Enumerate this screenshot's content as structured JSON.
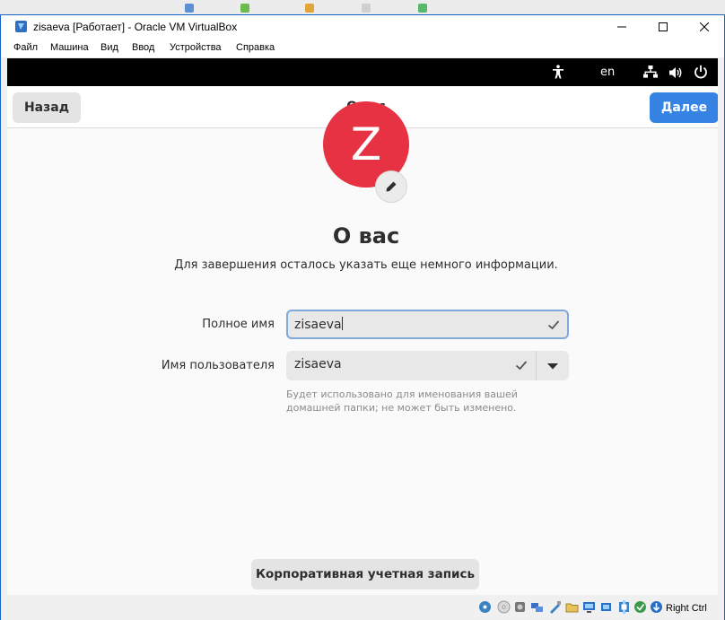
{
  "window": {
    "title": "zisaeva [Работает] - Oracle VM VirtualBox",
    "controls": [
      "minimize-icon",
      "maximize-icon",
      "close-icon"
    ]
  },
  "menubar": {
    "items": [
      "Файл",
      "Машина",
      "Вид",
      "Ввод",
      "Устройства",
      "Справка"
    ]
  },
  "topbar": {
    "accessibility_icon": "accessibility-icon",
    "language": "en",
    "status_icons": [
      "network-icon",
      "volume-icon",
      "power-icon"
    ]
  },
  "header": {
    "back_label": "Назад",
    "title": "О вас",
    "next_label": "Далее"
  },
  "avatar": {
    "initial": "Z",
    "color": "#e63242",
    "edit_icon": "pencil-icon"
  },
  "main": {
    "heading": "О вас",
    "subtitle": "Для завершения осталось указать еще немного информации."
  },
  "form": {
    "fullname_label": "Полное имя",
    "fullname_value": "zisaeva",
    "username_label": "Имя пользователя",
    "username_value": "zisaeva",
    "username_hint": "Будет использовано для именования вашей домашней папки; не может быть изменено."
  },
  "footer": {
    "enterprise_label": "Корпоративная учетная запись"
  },
  "statusbar": {
    "icons": [
      "hard-disk-icon",
      "optical-drive-icon",
      "audio-icon",
      "network-adapter-icon",
      "usb-icon",
      "shared-folders-icon",
      "display-icon",
      "video-capture-icon",
      "cpu-icon",
      "guest-additions-icon",
      "mouse-integration-icon"
    ],
    "host_key": "Right Ctrl"
  },
  "colors": {
    "accent": "#3584e4",
    "avatar": "#e63242",
    "window_border": "#1a64c8"
  }
}
